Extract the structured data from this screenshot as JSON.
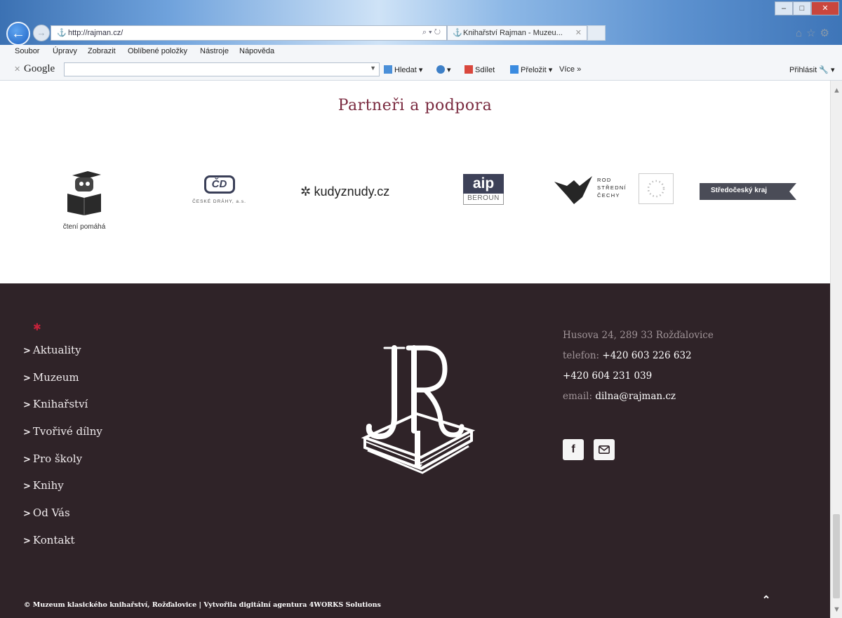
{
  "browser": {
    "address_url": "http://rajman.cz/",
    "address_controls": "⌕ ▾ ↻",
    "tab_title": "Knihařství Rajman - Muzeu...",
    "menu": [
      "Soubor",
      "Úpravy",
      "Zobrazit",
      "Oblíbené položky",
      "Nástroje",
      "Nápověda"
    ],
    "google_logo": "Google",
    "google_items": {
      "search": "Hledat",
      "share": "Sdílet",
      "translate": "Přeložit",
      "more": "Více »",
      "signin": "Přihlásit"
    }
  },
  "partners": {
    "title": "Partneři a podpora",
    "logos": {
      "cteni_caption": "čtení pomáhá",
      "cd_mark": "ČD",
      "cd_caption": "ČESKÉ DRÁHY, a.s.",
      "kudyznudy": "kudyznudy.cz",
      "aip_mark": "aip",
      "aip_caption": "BEROUN",
      "rod_lines": [
        "ROD",
        "STŘEDNÍ",
        "ČECHY"
      ],
      "stredocesky": "Středočeský kraj"
    }
  },
  "footer": {
    "nav": [
      "Aktuality",
      "Muzeum",
      "Knihařství",
      "Tvořivé dílny",
      "Pro školy",
      "Knihy",
      "Od Vás",
      "Kontakt"
    ],
    "address": "Husova 24, 289 33 Rožďalovice",
    "phone_label": "telefon:",
    "phone1": "+420 603 226 632",
    "phone2": "+420 604 231 039",
    "email_label": "email:",
    "email": "dilna@rajman.cz",
    "copyright": "© Muzeum klasického knihařství, Rožďalovice | Vytvořila digitální agentura 4WORKS Solutions"
  }
}
